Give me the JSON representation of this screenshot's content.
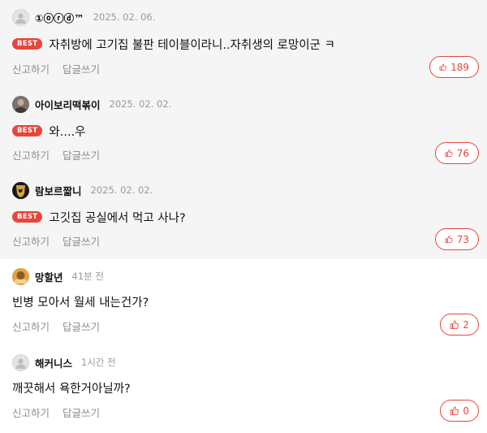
{
  "actions": {
    "report": "신고하기",
    "reply": "답글쓰기"
  },
  "badge": "BEST",
  "comments": [
    {
      "nick": "①ⓞⓡⓓ™",
      "date": "2025. 02. 06.",
      "text": "자취방에 고기집 불판 테이블이라니..자취생의 로망이군 ㅋ",
      "likes": "189",
      "avatar_icon": "default-user-icon"
    },
    {
      "nick": "아이보리떡볶이",
      "date": "2025. 02. 02.",
      "text": "와....우",
      "likes": "76",
      "avatar_icon": "profile-photo"
    },
    {
      "nick": "람보르짧니",
      "date": "2025. 02. 02.",
      "text": "고깃집 공실에서 먹고 사나?",
      "likes": "73",
      "avatar_icon": "lamborghini-logo"
    },
    {
      "nick": "망할년",
      "date": "41분 전",
      "text": "빈병 모아서 월세 내는건가?",
      "likes": "2",
      "avatar_icon": "profile-photo"
    },
    {
      "nick": "해커니스",
      "date": "1시간 전",
      "text": "깨끗해서 욕한거아닐까?",
      "likes": "0",
      "avatar_icon": "default-user-icon"
    }
  ],
  "colors": {
    "accent": "#e8453c",
    "best_bg": "#f5f5f5"
  }
}
